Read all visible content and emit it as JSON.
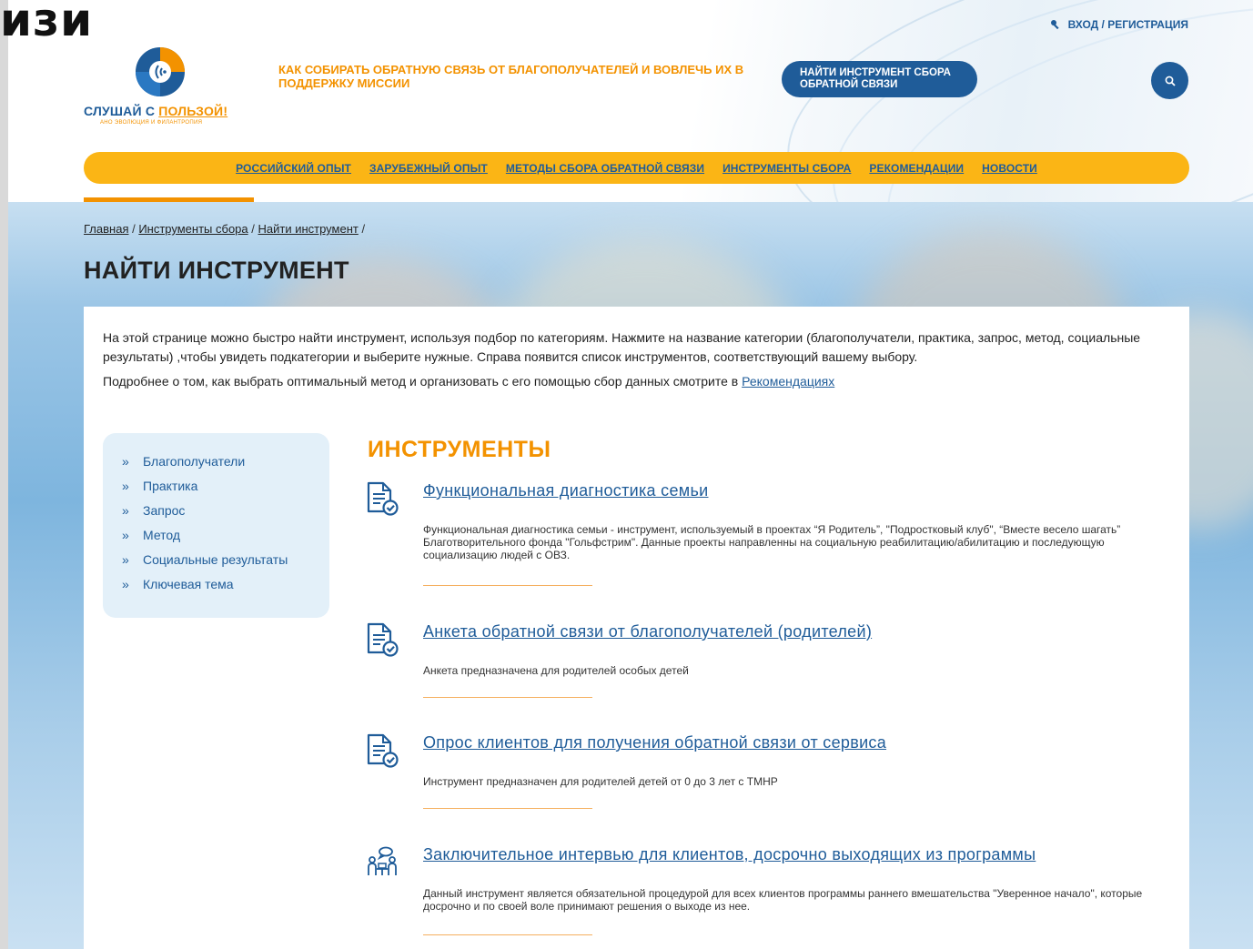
{
  "corner_fragment": "изи",
  "header": {
    "login_label": "Вход / Регистрация",
    "logo_name_part1": "СЛУШАЙ С ",
    "logo_name_part2": "ПОЛЬЗОЙ!",
    "logo_subtitle": "АНО ЭВОЛЮЦИЯ И ФИЛАНТРОПИЯ",
    "tagline": "Как собирать обратную связь от благополучателей и вовлечь их в поддержку миссии",
    "find_button_label": "Найти инструмент сбора обратной связи",
    "search_icon": "search-icon",
    "brand_blue": "#1f5c99",
    "brand_orange": "#f39200",
    "nav_yellow": "#fbb515"
  },
  "nav": {
    "items": [
      "Российский опыт",
      "Зарубежный опыт",
      "Методы сбора обратной связи",
      "Инструменты сбора",
      "Рекомендации",
      "Новости"
    ]
  },
  "breadcrumb": {
    "items": [
      "Главная",
      "Инструменты сбора",
      "Найти инструмент"
    ],
    "separator": " / "
  },
  "page": {
    "title": "Найти инструмент",
    "intro_1": "На этой странице можно быстро найти инструмент, используя подбор по категориям. Нажмите на название  категории (благополучатели, практика,  запрос, метод, социальные результаты) ,чтобы увидеть подкатегории  и   выберите нужные. Справа появится список инструментов, соответствующий вашему выбору.",
    "intro_2_text": "Подробнее о том, как выбрать оптимальный метод и  организовать с его помощью  сбор данных смотрите в ",
    "intro_2_link": "Рекомендациях"
  },
  "sidebar": {
    "chevron": "»",
    "items": [
      "Благополучатели",
      "Практика",
      "Запрос",
      "Метод",
      "Социальные результаты",
      "Ключевая тема"
    ]
  },
  "tools": {
    "heading": "Инструменты",
    "items": [
      {
        "title": "Функциональная диагностика семьи",
        "description": "Функциональная диагностика семьи - инструмент, используемый в проектах “Я Родитель”, \"Подростковый клуб\", “Вместе весело шагать” Благотворительного фонда \"Гольфстрим\". Данные проекты направленны на социальную реабилитацию/абилитацию и последующую социализацию людей с ОВЗ.",
        "icon": "document-check-icon"
      },
      {
        "title": "Анкета обратной связи от благополучателей (родителей)",
        "description": "Анкета предназначена для родителей особых детей",
        "icon": "document-check-icon"
      },
      {
        "title": "Опрос клиентов для получения обратной связи от сервиса",
        "description": "Инструмент предназначен для родителей детей от 0 до 3 лет с ТМНР",
        "icon": "document-check-icon"
      },
      {
        "title": "Заключительное интервью для клиентов, досрочно выходящих из программы",
        "description": "Данный инструмент является обязательной процедурой для всех клиентов программы раннего вмешательства \"Уверенное начало\", которые досрочно и по своей воле принимают решения о выходе из нее.",
        "icon": "interview-icon"
      }
    ]
  }
}
